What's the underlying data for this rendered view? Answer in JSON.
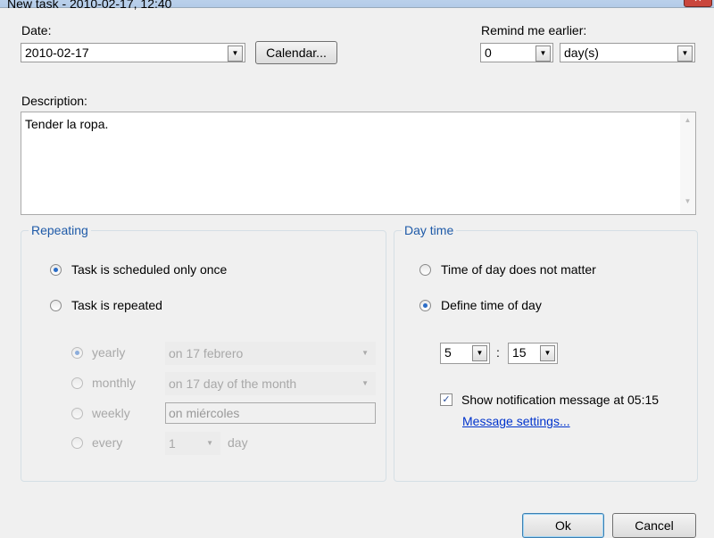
{
  "window": {
    "title": "New task - 2010-02-17, 12:40",
    "close": "✕"
  },
  "date": {
    "label": "Date:",
    "value": "2010-02-17",
    "calendar_button": "Calendar..."
  },
  "remind": {
    "label": "Remind me earlier:",
    "amount": "0",
    "unit": "day(s)"
  },
  "description": {
    "label": "Description:",
    "value": "Tender la ropa."
  },
  "repeating": {
    "legend": "Repeating",
    "once": "Task is scheduled only once",
    "repeated": "Task is repeated",
    "once_selected": true,
    "options": [
      {
        "label": "yearly",
        "value": "on 17 febrero"
      },
      {
        "label": "monthly",
        "value": "on 17 day of the month"
      },
      {
        "label": "weekly",
        "value": "on miércoles"
      },
      {
        "label": "every",
        "value": "1",
        "suffix": "day"
      }
    ]
  },
  "daytime": {
    "legend": "Day time",
    "no_matter": "Time of day does not matter",
    "define": "Define time of day",
    "hour": "5",
    "sep": ":",
    "minute": "15",
    "notify_label": "Show notification message at 05:15",
    "notify_checked": true,
    "message_settings": "Message settings..."
  },
  "buttons": {
    "ok": "Ok",
    "cancel": "Cancel"
  }
}
